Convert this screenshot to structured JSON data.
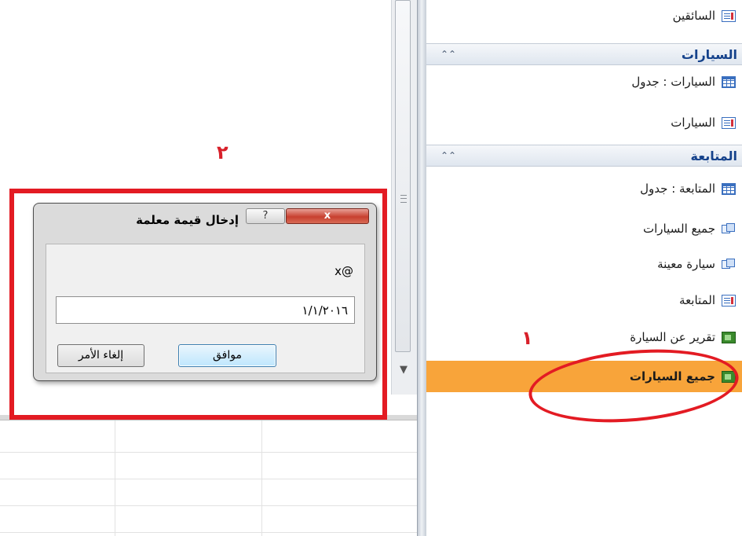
{
  "nav": {
    "items": [
      {
        "label": "السائقين",
        "icon": "form-icon"
      },
      {
        "group": "السيارات",
        "chevron": "«"
      },
      {
        "label": "السيارات : جدول",
        "icon": "table-icon"
      },
      {
        "label": "السيارات",
        "icon": "form-icon"
      },
      {
        "group": "المتابعة",
        "chevron": "«"
      },
      {
        "label": "المتابعة : جدول",
        "icon": "table-icon"
      },
      {
        "label": "جميع السيارات",
        "icon": "query-icon"
      },
      {
        "label": "سيارة معينة",
        "icon": "query-icon"
      },
      {
        "label": "المتابعة",
        "icon": "form-icon"
      },
      {
        "label": "تقرير عن السيارة",
        "icon": "report-icon"
      },
      {
        "label": "جميع السيارات",
        "icon": "report-icon",
        "selected": true
      }
    ]
  },
  "annotations": {
    "num1": "١",
    "num2": "٢",
    "color": "#e31b23"
  },
  "dialog": {
    "title": "إدخال قيمة معلمة",
    "close": "x",
    "help": "?",
    "prompt": "x@",
    "value": "١/١/٢٠١٦",
    "ok": "موافق",
    "cancel": "إلغاء الأمر"
  },
  "colors": {
    "selected": "#f8a43a",
    "group_title": "#15428b"
  }
}
